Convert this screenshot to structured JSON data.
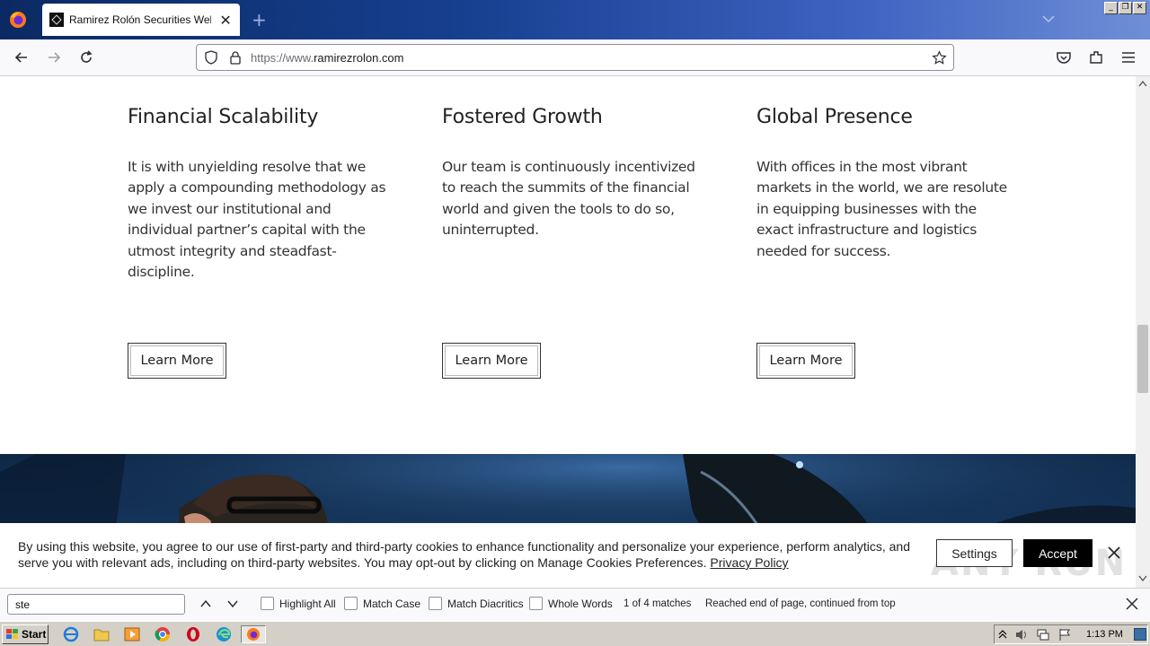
{
  "browser": {
    "tab_title": "Ramirez Rolón Securities Website | ",
    "url_scheme": "https://www.",
    "url_domain": "ramirezrolon.com"
  },
  "columns": [
    {
      "heading": "Financial Scalability",
      "body": "It is with unyielding resolve that we apply a compounding methodology as we invest our institutional and individual partner’s capital with the utmost integrity and steadfast-discipline.",
      "button": "Learn More"
    },
    {
      "heading": "Fostered Growth",
      "body": "Our team is continuously incentivized to reach the summits of the financial world and given the tools to do so, uninterrupted.",
      "button": "Learn More"
    },
    {
      "heading": "Global Presence",
      "body": "With offices in the most vibrant markets in the world, we are resolute in equipping businesses with the exact infrastructure and logistics needed for success.",
      "button": "Learn More"
    }
  ],
  "cookie_banner": {
    "text": "By using this website, you agree to our use of first-party and third-party cookies to enhance functionality and personalize your experience, perform analytics, and serve you with relevant ads, including on third-party websites. You may opt-out by clicking on Manage Cookies Preferences. ",
    "link": "Privacy Policy",
    "settings_label": "Settings",
    "accept_label": "Accept",
    "watermark": "ANY RUN"
  },
  "find_bar": {
    "query": "ste",
    "highlight_all": "Highlight All",
    "match_case": "Match Case",
    "match_diacritics": "Match Diacritics",
    "whole_words": "Whole Words",
    "match_count": "1 of 4 matches",
    "status": "Reached end of page, continued from top"
  },
  "taskbar": {
    "start_label": "Start",
    "clock": "1:13 PM"
  },
  "colors": {
    "accept_bg": "#000000",
    "titlebar": "#163f8f"
  }
}
